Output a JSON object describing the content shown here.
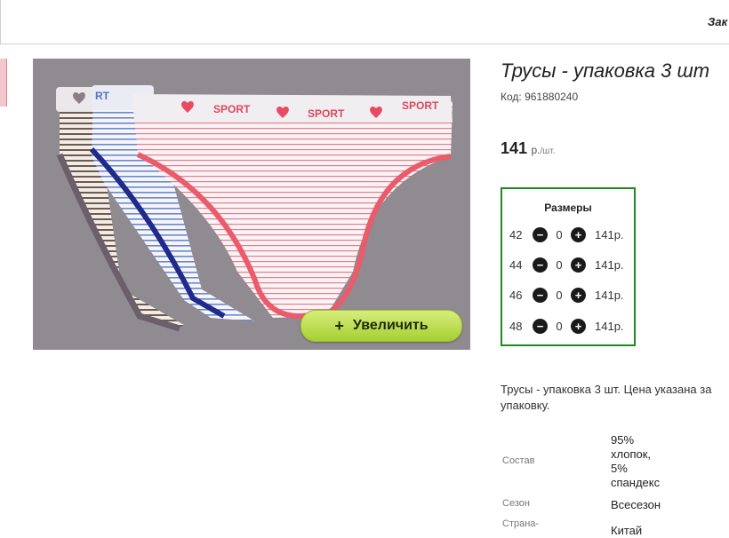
{
  "header": {
    "right_link": "Зак"
  },
  "product": {
    "title": "Трусы - упаковка 3 шт",
    "code": "Код: 961880240",
    "price": "141",
    "price_unit": "р.",
    "price_per": "/шт.",
    "image": {
      "waistband_text": [
        "RT",
        "SPORT",
        "SPORT",
        "SPORT"
      ],
      "zoom_label": "Увеличить",
      "zoom_plus": "+"
    }
  },
  "sizes": {
    "title": "Размеры",
    "minus_glyph": "−",
    "plus_glyph": "+",
    "rows": [
      {
        "size": "42",
        "qty": "0",
        "price": "141р."
      },
      {
        "size": "44",
        "qty": "0",
        "price": "141р."
      },
      {
        "size": "46",
        "qty": "0",
        "price": "141р."
      },
      {
        "size": "48",
        "qty": "0",
        "price": "141р."
      }
    ]
  },
  "description": {
    "line1": "Трусы - упаковка 3 шт. Цена указана за",
    "line2": "упаковку."
  },
  "specs": {
    "composition_label": "Состав",
    "composition_lines": [
      "95%",
      "хлопок,",
      "5%",
      "спандекс"
    ],
    "season_label": "Сезон",
    "season_value": "Всесезон",
    "country_label": "Страна-",
    "country_value": "Китай"
  },
  "colors": {
    "accent_green": "#1e8a1e",
    "button_green": "#a6cf32",
    "photo_bg": "#8f8b91"
  }
}
